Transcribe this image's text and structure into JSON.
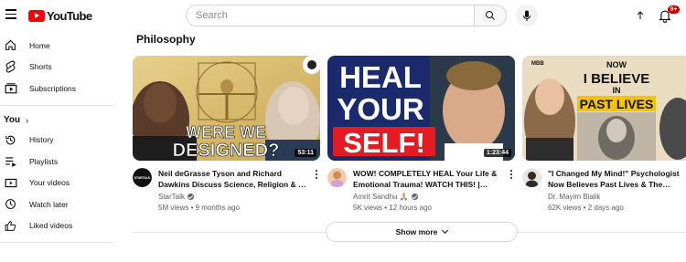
{
  "header": {
    "logo_text": "YouTube",
    "search_placeholder": "Search",
    "notification_count": "9+"
  },
  "sidebar": {
    "items": [
      {
        "label": "Home",
        "icon": "home-icon"
      },
      {
        "label": "Shorts",
        "icon": "shorts-icon"
      },
      {
        "label": "Subscriptions",
        "icon": "subscriptions-icon"
      }
    ],
    "you_label": "You",
    "you_items": [
      {
        "label": "History",
        "icon": "history-icon"
      },
      {
        "label": "Playlists",
        "icon": "playlists-icon"
      },
      {
        "label": "Your videos",
        "icon": "your-videos-icon"
      },
      {
        "label": "Watch later",
        "icon": "watch-later-icon"
      },
      {
        "label": "Liked videos",
        "icon": "liked-videos-icon"
      }
    ]
  },
  "shelf": {
    "title": "Philosophy",
    "show_more_label": "Show more",
    "videos": [
      {
        "thumb_text_1": "WERE WE",
        "thumb_text_2": "DESIGNED?",
        "duration": "53:11",
        "title": "Neil deGrasse Tyson and Richard Dawkins Discuss Science, Religion & …",
        "channel": "StarTalk",
        "avatar_text": "STARTALK",
        "verified": true,
        "stats": "5M views • 9 months ago"
      },
      {
        "thumb_text_1": "HEAL",
        "thumb_text_2": "YOUR",
        "thumb_text_3": "SELF!",
        "duration": "1:23:44",
        "title": "WOW! COMPLETELY HEAL Your Life & Emotional Trauma! WATCH THIS! |…",
        "channel": "Amrit Sandhu 🙏🏼",
        "verified": true,
        "stats": "5K views • 12 hours ago"
      },
      {
        "thumb_text_1": "NOW",
        "thumb_text_2": "I BELIEVE",
        "thumb_text_3": "IN",
        "thumb_text_4": "PAST LIVES",
        "thumb_corner": "MBB",
        "title": "\"I Changed My Mind!\" Psychologist Now Believes Past Lives & The…",
        "channel": "Dr. Mayim Bialik",
        "verified": false,
        "stats": "62K views • 2 days ago"
      }
    ]
  },
  "colors": {
    "brand_red": "#ff0000",
    "badge_red": "#cc0000",
    "text_primary": "#0f0f0f",
    "text_secondary": "#606060"
  }
}
